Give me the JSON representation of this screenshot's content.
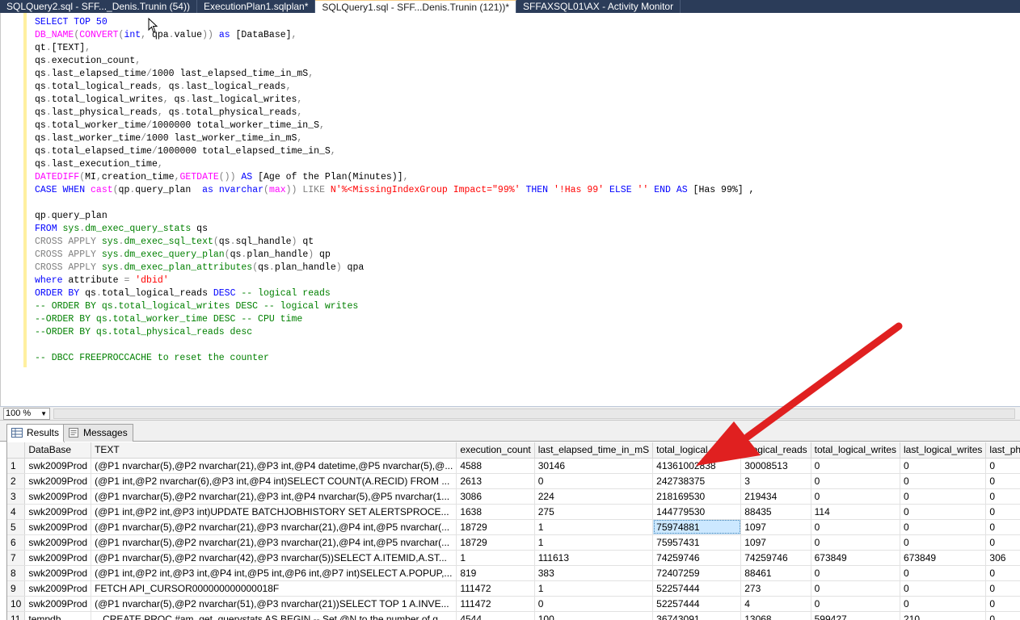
{
  "tabs": [
    {
      "label": "SQLQuery2.sql - SFF..._Denis.Trunin (54))",
      "active": false
    },
    {
      "label": "ExecutionPlan1.sqlplan*",
      "active": false
    },
    {
      "label": "SQLQuery1.sql - SFF...Denis.Trunin (121))*",
      "active": true
    },
    {
      "label": "SFFAXSQL01\\AX - Activity Monitor",
      "active": false
    }
  ],
  "editor": {
    "lines": [
      [
        [
          "kw",
          "SELECT TOP 50"
        ]
      ],
      [
        [
          "fn",
          "DB_NAME"
        ],
        [
          "gy",
          "("
        ],
        [
          "fn",
          "CONVERT"
        ],
        [
          "gy",
          "("
        ],
        [
          "kw",
          "int"
        ],
        [
          "gy",
          ","
        ],
        [
          "t",
          " qpa"
        ],
        [
          "gy",
          "."
        ],
        [
          "t",
          "value"
        ],
        [
          "gy",
          "))"
        ],
        [
          "t",
          " "
        ],
        [
          "kw",
          "as"
        ],
        [
          "t",
          " [DataBase]"
        ],
        [
          "gy",
          ","
        ]
      ],
      [
        [
          "t",
          "qt"
        ],
        [
          "gy",
          "."
        ],
        [
          "t",
          "[TEXT]"
        ],
        [
          "gy",
          ","
        ]
      ],
      [
        [
          "t",
          "qs"
        ],
        [
          "gy",
          "."
        ],
        [
          "t",
          "execution_count"
        ],
        [
          "gy",
          ","
        ]
      ],
      [
        [
          "t",
          "qs"
        ],
        [
          "gy",
          "."
        ],
        [
          "t",
          "last_elapsed_time"
        ],
        [
          "gy",
          "/"
        ],
        [
          "t",
          "1000 last_elapsed_time_in_mS"
        ],
        [
          "gy",
          ","
        ]
      ],
      [
        [
          "t",
          "qs"
        ],
        [
          "gy",
          "."
        ],
        [
          "t",
          "total_logical_reads"
        ],
        [
          "gy",
          ","
        ],
        [
          "t",
          " qs"
        ],
        [
          "gy",
          "."
        ],
        [
          "t",
          "last_logical_reads"
        ],
        [
          "gy",
          ","
        ]
      ],
      [
        [
          "t",
          "qs"
        ],
        [
          "gy",
          "."
        ],
        [
          "t",
          "total_logical_writes"
        ],
        [
          "gy",
          ","
        ],
        [
          "t",
          " qs"
        ],
        [
          "gy",
          "."
        ],
        [
          "t",
          "last_logical_writes"
        ],
        [
          "gy",
          ","
        ]
      ],
      [
        [
          "t",
          "qs"
        ],
        [
          "gy",
          "."
        ],
        [
          "t",
          "last_physical_reads"
        ],
        [
          "gy",
          ","
        ],
        [
          "t",
          " qs"
        ],
        [
          "gy",
          "."
        ],
        [
          "t",
          "total_physical_reads"
        ],
        [
          "gy",
          ","
        ]
      ],
      [
        [
          "t",
          "qs"
        ],
        [
          "gy",
          "."
        ],
        [
          "t",
          "total_worker_time"
        ],
        [
          "gy",
          "/"
        ],
        [
          "t",
          "1000000 total_worker_time_in_S"
        ],
        [
          "gy",
          ","
        ]
      ],
      [
        [
          "t",
          "qs"
        ],
        [
          "gy",
          "."
        ],
        [
          "t",
          "last_worker_time"
        ],
        [
          "gy",
          "/"
        ],
        [
          "t",
          "1000 last_worker_time_in_mS"
        ],
        [
          "gy",
          ","
        ]
      ],
      [
        [
          "t",
          "qs"
        ],
        [
          "gy",
          "."
        ],
        [
          "t",
          "total_elapsed_time"
        ],
        [
          "gy",
          "/"
        ],
        [
          "t",
          "1000000 total_elapsed_time_in_S"
        ],
        [
          "gy",
          ","
        ]
      ],
      [
        [
          "t",
          "qs"
        ],
        [
          "gy",
          "."
        ],
        [
          "t",
          "last_execution_time"
        ],
        [
          "gy",
          ","
        ]
      ],
      [
        [
          "fn",
          "DATEDIFF"
        ],
        [
          "gy",
          "("
        ],
        [
          "t",
          "MI"
        ],
        [
          "gy",
          ","
        ],
        [
          "t",
          "creation_time"
        ],
        [
          "gy",
          ","
        ],
        [
          "fn",
          "GETDATE"
        ],
        [
          "gy",
          "())"
        ],
        [
          "t",
          " "
        ],
        [
          "kw",
          "AS"
        ],
        [
          "t",
          " [Age of the Plan(Minutes)]"
        ],
        [
          "gy",
          ","
        ]
      ],
      [
        [
          "kw",
          "CASE WHEN"
        ],
        [
          "t",
          " "
        ],
        [
          "fn",
          "cast"
        ],
        [
          "gy",
          "("
        ],
        [
          "t",
          "qp"
        ],
        [
          "gy",
          "."
        ],
        [
          "t",
          "query_plan  "
        ],
        [
          "kw",
          "as"
        ],
        [
          "t",
          " "
        ],
        [
          "kw",
          "nvarchar"
        ],
        [
          "gy",
          "("
        ],
        [
          "fn",
          "max"
        ],
        [
          "gy",
          "))"
        ],
        [
          "t",
          " "
        ],
        [
          "gy",
          "LIKE"
        ],
        [
          "t",
          " "
        ],
        [
          "st",
          "N'%<MissingIndexGroup Impact=\"99%'"
        ],
        [
          "t",
          " "
        ],
        [
          "kw",
          "THEN"
        ],
        [
          "t",
          " "
        ],
        [
          "st",
          "'!Has 99'"
        ],
        [
          "t",
          " "
        ],
        [
          "kw",
          "ELSE"
        ],
        [
          "t",
          " "
        ],
        [
          "st",
          "''"
        ],
        [
          "t",
          " "
        ],
        [
          "kw",
          "END AS"
        ],
        [
          "t",
          " [Has 99%] ,"
        ]
      ],
      [],
      [
        [
          "t",
          "qp"
        ],
        [
          "gy",
          "."
        ],
        [
          "t",
          "query_plan"
        ]
      ],
      [
        [
          "kw",
          "FROM"
        ],
        [
          "t",
          " "
        ],
        [
          "sy",
          "sys"
        ],
        [
          "gy",
          "."
        ],
        [
          "sy",
          "dm_exec_query_stats"
        ],
        [
          "t",
          " qs"
        ]
      ],
      [
        [
          "gy",
          "CROSS APPLY"
        ],
        [
          "t",
          " "
        ],
        [
          "sy",
          "sys"
        ],
        [
          "gy",
          "."
        ],
        [
          "sy",
          "dm_exec_sql_text"
        ],
        [
          "gy",
          "("
        ],
        [
          "t",
          "qs"
        ],
        [
          "gy",
          "."
        ],
        [
          "t",
          "sql_handle"
        ],
        [
          "gy",
          ")"
        ],
        [
          "t",
          " qt"
        ]
      ],
      [
        [
          "gy",
          "CROSS APPLY"
        ],
        [
          "t",
          " "
        ],
        [
          "sy",
          "sys"
        ],
        [
          "gy",
          "."
        ],
        [
          "sy",
          "dm_exec_query_plan"
        ],
        [
          "gy",
          "("
        ],
        [
          "t",
          "qs"
        ],
        [
          "gy",
          "."
        ],
        [
          "t",
          "plan_handle"
        ],
        [
          "gy",
          ")"
        ],
        [
          "t",
          " qp"
        ]
      ],
      [
        [
          "gy",
          "CROSS APPLY"
        ],
        [
          "t",
          " "
        ],
        [
          "sy",
          "sys"
        ],
        [
          "gy",
          "."
        ],
        [
          "sy",
          "dm_exec_plan_attributes"
        ],
        [
          "gy",
          "("
        ],
        [
          "t",
          "qs"
        ],
        [
          "gy",
          "."
        ],
        [
          "t",
          "plan_handle"
        ],
        [
          "gy",
          ")"
        ],
        [
          "t",
          " qpa"
        ]
      ],
      [
        [
          "kw",
          "where"
        ],
        [
          "t",
          " attribute "
        ],
        [
          "gy",
          "="
        ],
        [
          "t",
          " "
        ],
        [
          "st",
          "'dbid'"
        ]
      ],
      [
        [
          "kw",
          "ORDER BY"
        ],
        [
          "t",
          " qs"
        ],
        [
          "gy",
          "."
        ],
        [
          "t",
          "total_logical_reads "
        ],
        [
          "kw",
          "DESC"
        ],
        [
          "t",
          " "
        ],
        [
          "cm",
          "-- logical reads"
        ]
      ],
      [
        [
          "cm",
          "-- ORDER BY qs.total_logical_writes DESC -- logical writes"
        ]
      ],
      [
        [
          "cm",
          "--ORDER BY qs.total_worker_time DESC -- CPU time"
        ]
      ],
      [
        [
          "cm",
          "--ORDER BY qs.total_physical_reads desc"
        ]
      ],
      [],
      [
        [
          "cm",
          "-- DBCC FREEPROCCACHE to reset the counter"
        ]
      ]
    ]
  },
  "zoom": {
    "value": "100 %"
  },
  "result_tabs": [
    {
      "label": "Results",
      "icon": "grid-icon",
      "active": true
    },
    {
      "label": "Messages",
      "icon": "messages-icon",
      "active": false
    }
  ],
  "grid": {
    "columns": [
      "DataBase",
      "TEXT",
      "execution_count",
      "last_elapsed_time_in_mS",
      "total_logical_reads",
      "last_logical_reads",
      "total_logical_writes",
      "last_logical_writes",
      "last_physical_reads"
    ],
    "column_headers_visible": [
      "DataBase",
      "TEXT",
      "execution_count",
      "last_elapsed_time_in_mS",
      "total_logical_reads",
      "_logical_reads",
      "total_logical_writes",
      "last_logical_writes",
      "last_physical_"
    ],
    "rows": [
      [
        "1",
        "swk2009Prod",
        "(@P1 nvarchar(5),@P2 nvarchar(21),@P3 int,@P4 datetime,@P5 nvarchar(5),@...",
        "4588",
        "30146",
        "41361002838",
        "30008513",
        "0",
        "0",
        "0"
      ],
      [
        "2",
        "swk2009Prod",
        "(@P1 int,@P2 nvarchar(6),@P3 int,@P4 int)SELECT COUNT(A.RECID) FROM ...",
        "2613",
        "0",
        "242738375",
        "3",
        "0",
        "0",
        "0"
      ],
      [
        "3",
        "swk2009Prod",
        "(@P1 nvarchar(5),@P2 nvarchar(21),@P3 int,@P4 nvarchar(5),@P5 nvarchar(1...",
        "3086",
        "224",
        "218169530",
        "219434",
        "0",
        "0",
        "0"
      ],
      [
        "4",
        "swk2009Prod",
        "(@P1 int,@P2 int,@P3 int)UPDATE BATCHJOBHISTORY SET ALERTSPROCE...",
        "1638",
        "275",
        "144779530",
        "88435",
        "114",
        "0",
        "0"
      ],
      [
        "5",
        "swk2009Prod",
        "(@P1 nvarchar(5),@P2 nvarchar(21),@P3 nvarchar(21),@P4 int,@P5 nvarchar(...",
        "18729",
        "1",
        "75974881",
        "1097",
        "0",
        "0",
        "0"
      ],
      [
        "6",
        "swk2009Prod",
        "(@P1 nvarchar(5),@P2 nvarchar(21),@P3 nvarchar(21),@P4 int,@P5 nvarchar(...",
        "18729",
        "1",
        "75957431",
        "1097",
        "0",
        "0",
        "0"
      ],
      [
        "7",
        "swk2009Prod",
        "(@P1 nvarchar(5),@P2 nvarchar(42),@P3 nvarchar(5))SELECT A.ITEMID,A.ST...",
        "1",
        "111613",
        "74259746",
        "74259746",
        "673849",
        "673849",
        "306"
      ],
      [
        "8",
        "swk2009Prod",
        "(@P1 int,@P2 int,@P3 int,@P4 int,@P5 int,@P6 int,@P7 int)SELECT A.POPUP,...",
        "819",
        "383",
        "72407259",
        "88461",
        "0",
        "0",
        "0"
      ],
      [
        "9",
        "swk2009Prod",
        "FETCH API_CURSOR000000000000018F",
        "111472",
        "1",
        "52257444",
        "273",
        "0",
        "0",
        "0"
      ],
      [
        "10",
        "swk2009Prod",
        "(@P1 nvarchar(5),@P2 nvarchar(51),@P3 nvarchar(21))SELECT TOP 1 A.INVE...",
        "111472",
        "0",
        "52257444",
        "4",
        "0",
        "0",
        "0"
      ],
      [
        "11",
        "tempdb",
        "...CREATE PROC #am_get_querystats AS   BEGIN   -- Set @N to the number of q...",
        "4544",
        "100",
        "36743091",
        "13068",
        "599427",
        "210",
        "0"
      ]
    ],
    "selected_cell": {
      "row": 4,
      "column": "total_logical_reads"
    }
  },
  "colors": {
    "tab_bar": "#2b3c59",
    "keyword": "#0000ff",
    "function": "#ff00ff",
    "string": "#ff0000",
    "comment": "#008000",
    "annotation_arrow": "#e02020"
  }
}
